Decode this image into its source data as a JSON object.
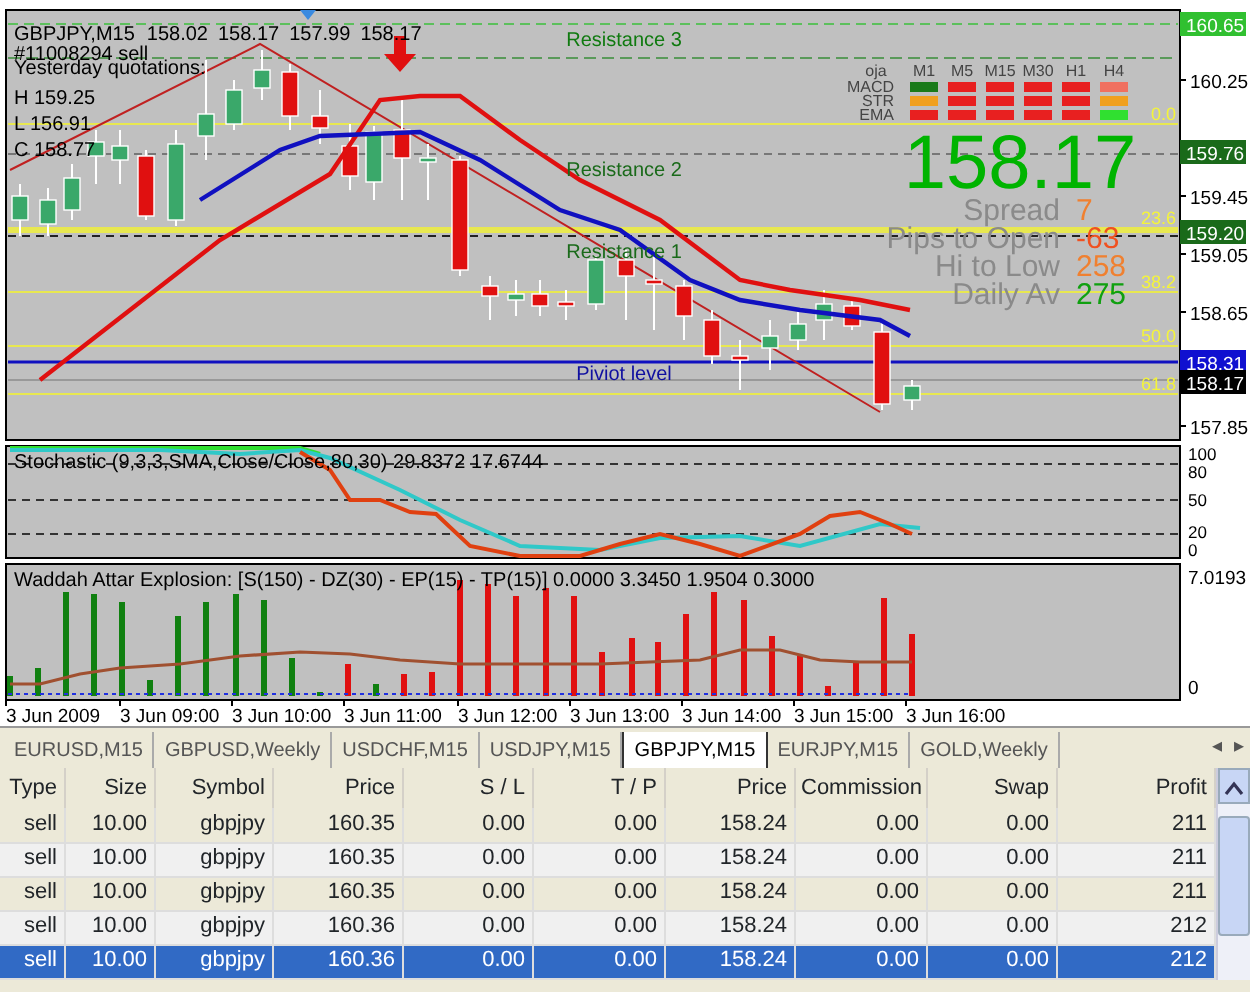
{
  "chart": {
    "symbol": "GBPJPY,M15",
    "quotes": [
      "158.02",
      "158.17",
      "157.99",
      "158.17"
    ],
    "order_label": "#11008294 sell",
    "yesterday": {
      "title": "Yesterday quotations:",
      "lines": [
        "H 159.25",
        "L 156.91",
        "C 158.77"
      ]
    },
    "levels": [
      {
        "label": "Resistance 3",
        "kind": "resistance"
      },
      {
        "label": "Resistance 2",
        "kind": "resistance"
      },
      {
        "label": "Resistance 1",
        "kind": "resistance"
      },
      {
        "label": "Piviot level",
        "kind": "pivot"
      }
    ],
    "fib_labels": [
      "0.0",
      "23.6",
      "38.2",
      "50.0",
      "61.8"
    ],
    "signals": {
      "columns": [
        "oja",
        "M1",
        "M5",
        "M15",
        "M30",
        "H1",
        "H4"
      ],
      "rows": [
        {
          "label": "MACD",
          "cells": [
            {
              "color": "#1a7a1a"
            },
            {
              "color": "#e82020"
            },
            {
              "color": "#e82020"
            },
            {
              "color": "#e82020"
            },
            {
              "color": "#e82020"
            },
            {
              "color": "#f07060"
            }
          ]
        },
        {
          "label": "STR",
          "cells": [
            {
              "color": "#f0a020"
            },
            {
              "color": "#e82020"
            },
            {
              "color": "#e82020"
            },
            {
              "color": "#e82020"
            },
            {
              "color": "#e82020"
            },
            {
              "color": "#f0a020"
            }
          ]
        },
        {
          "label": "EMA",
          "cells": [
            {
              "color": "#e82020"
            },
            {
              "color": "#e82020"
            },
            {
              "color": "#e82020"
            },
            {
              "color": "#e82020"
            },
            {
              "color": "#e82020"
            },
            {
              "color": "#30e030"
            }
          ]
        }
      ]
    },
    "price": "158.17",
    "stats": [
      {
        "label": "Spread",
        "value": "7",
        "color": "#f08030"
      },
      {
        "label": "Pips to Open",
        "value": "-63",
        "color": "#f05020"
      },
      {
        "label": "Hi to Low",
        "value": "258",
        "color": "#f08030"
      },
      {
        "label": "Daily Av",
        "value": "275",
        "color": "#10a010"
      }
    ],
    "price_axis": [
      {
        "label": "160.65",
        "kind": "marker",
        "color": "#30c030"
      },
      {
        "label": "160.25",
        "kind": "tick"
      },
      {
        "label": "159.76",
        "kind": "marker",
        "color": "#1a6a1a"
      },
      {
        "label": "159.45",
        "kind": "tick"
      },
      {
        "label": "159.20",
        "kind": "marker",
        "color": "#1a6a1a"
      },
      {
        "label": "159.05",
        "kind": "tick"
      },
      {
        "label": "158.65",
        "kind": "tick"
      },
      {
        "label": "158.31",
        "kind": "marker",
        "color": "#1010d0"
      },
      {
        "label": "158.17",
        "kind": "marker",
        "color": "#000000"
      },
      {
        "label": "157.85",
        "kind": "tick"
      }
    ]
  },
  "stochastic": {
    "title": "Stochastic (9,3,3,SMA,Close/Close,80,30) 29.8372 17.6744",
    "ticks": [
      "100",
      "80",
      "50",
      "20",
      "0"
    ]
  },
  "waddah": {
    "title": "Waddah Attar Explosion: [S(150) - DZ(30) - EP(15) - TP(15)] 0.0000 3.3450 1.9504 0.3000",
    "ticks": [
      "7.0193",
      "0"
    ]
  },
  "time_axis": [
    "3 Jun 2009",
    "3 Jun 09:00",
    "3 Jun 10:00",
    "3 Jun 11:00",
    "3 Jun 12:00",
    "3 Jun 13:00",
    "3 Jun 14:00",
    "3 Jun 15:00",
    "3 Jun 16:00"
  ],
  "tabs": [
    {
      "label": "EURUSD,M15",
      "selected": false
    },
    {
      "label": "GBPUSD,Weekly",
      "selected": false
    },
    {
      "label": "USDCHF,M15",
      "selected": false
    },
    {
      "label": "USDJPY,M15",
      "selected": false
    },
    {
      "label": "GBPJPY,M15",
      "selected": true
    },
    {
      "label": "EURJPY,M15",
      "selected": false
    },
    {
      "label": "GOLD,Weekly",
      "selected": false
    }
  ],
  "tab_scroll": [
    "◂",
    "▸"
  ],
  "positions": {
    "columns": [
      "Type",
      "Size",
      "Symbol",
      "Price",
      "S / L",
      "T / P",
      "Price",
      "Commission",
      "Swap",
      "Profit"
    ],
    "rows": [
      {
        "cells": [
          "sell",
          "10.00",
          "gbpjpy",
          "160.35",
          "0.00",
          "0.00",
          "158.24",
          "0.00",
          "0.00",
          "211"
        ],
        "selected": false
      },
      {
        "cells": [
          "sell",
          "10.00",
          "gbpjpy",
          "160.35",
          "0.00",
          "0.00",
          "158.24",
          "0.00",
          "0.00",
          "211"
        ],
        "selected": false
      },
      {
        "cells": [
          "sell",
          "10.00",
          "gbpjpy",
          "160.35",
          "0.00",
          "0.00",
          "158.24",
          "0.00",
          "0.00",
          "211"
        ],
        "selected": false
      },
      {
        "cells": [
          "sell",
          "10.00",
          "gbpjpy",
          "160.36",
          "0.00",
          "0.00",
          "158.24",
          "0.00",
          "0.00",
          "212"
        ],
        "selected": false
      },
      {
        "cells": [
          "sell",
          "10.00",
          "gbpjpy",
          "160.36",
          "0.00",
          "0.00",
          "158.24",
          "0.00",
          "0.00",
          "212"
        ],
        "selected": true
      }
    ]
  }
}
